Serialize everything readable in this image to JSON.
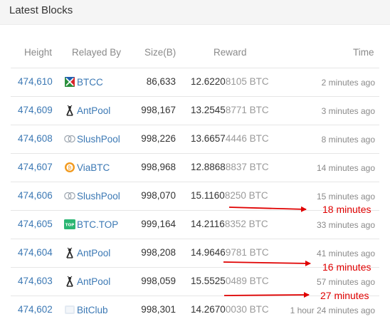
{
  "panel": {
    "title": "Latest Blocks"
  },
  "columns": {
    "height": "Height",
    "relayed_by": "Relayed By",
    "size": "Size(B)",
    "reward": "Reward",
    "time": "Time"
  },
  "rows": [
    {
      "height": "474,610",
      "pool": "BTCC",
      "pool_icon": "btcc-logo-icon",
      "size": "86,633",
      "reward_main": "12.6220",
      "reward_dim": "8105",
      "unit": "BTC",
      "time": "2 minutes ago"
    },
    {
      "height": "474,609",
      "pool": "AntPool",
      "pool_icon": "antpool-logo-icon",
      "size": "998,167",
      "reward_main": "13.2545",
      "reward_dim": "8771",
      "unit": "BTC",
      "time": "3 minutes ago"
    },
    {
      "height": "474,608",
      "pool": "SlushPool",
      "pool_icon": "slushpool-logo-icon",
      "size": "998,226",
      "reward_main": "13.6657",
      "reward_dim": "4446",
      "unit": "BTC",
      "time": "8 minutes ago"
    },
    {
      "height": "474,607",
      "pool": "ViaBTC",
      "pool_icon": "viabtc-logo-icon",
      "size": "998,968",
      "reward_main": "12.8868",
      "reward_dim": "8837",
      "unit": "BTC",
      "time": "14 minutes ago"
    },
    {
      "height": "474,606",
      "pool": "SlushPool",
      "pool_icon": "slushpool-logo-icon",
      "size": "998,070",
      "reward_main": "15.1160",
      "reward_dim": "8250",
      "unit": "BTC",
      "time": "15 minutes ago"
    },
    {
      "height": "474,605",
      "pool": "BTC.TOP",
      "pool_icon": "btctop-logo-icon",
      "size": "999,164",
      "reward_main": "14.2116",
      "reward_dim": "8352",
      "unit": "BTC",
      "time": "33 minutes ago"
    },
    {
      "height": "474,604",
      "pool": "AntPool",
      "pool_icon": "antpool-logo-icon",
      "size": "998,208",
      "reward_main": "14.9646",
      "reward_dim": "9781",
      "unit": "BTC",
      "time": "41 minutes ago"
    },
    {
      "height": "474,603",
      "pool": "AntPool",
      "pool_icon": "antpool-logo-icon",
      "size": "998,059",
      "reward_main": "15.5525",
      "reward_dim": "0489",
      "unit": "BTC",
      "time": "57 minutes ago"
    },
    {
      "height": "474,602",
      "pool": "BitClub",
      "pool_icon": "bitclub-logo-icon",
      "size": "998,301",
      "reward_main": "14.2670",
      "reward_dim": "0030",
      "unit": "BTC",
      "time": "1 hour 24 minutes ago"
    }
  ],
  "annotations": [
    {
      "label": "18 minutes",
      "color": "#e00000"
    },
    {
      "label": "16 minutes",
      "color": "#e00000"
    },
    {
      "label": "27 minutes",
      "color": "#e00000"
    }
  ],
  "colors": {
    "link": "#3b78b4",
    "text": "#333333",
    "muted": "#8a8a8a",
    "annotation": "#e00000"
  }
}
